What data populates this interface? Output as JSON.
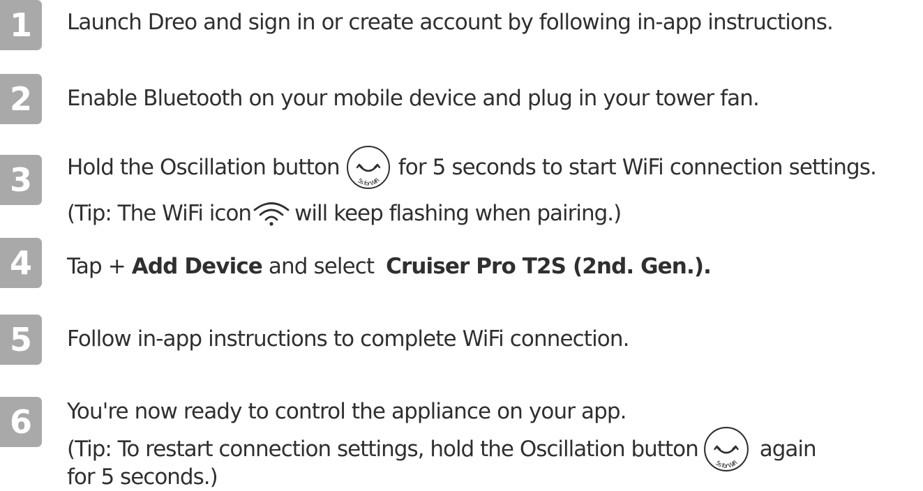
{
  "steps": [
    {
      "number": "1",
      "text": "Launch Dreo and sign in or create account by following in-app instructions."
    },
    {
      "number": "2",
      "text": "Enable Bluetooth on your mobile device and plug in your tower fan."
    },
    {
      "number": "3",
      "text_before": "Hold the Oscillation button",
      "text_after": "for 5 seconds to start WiFi connection settings.",
      "tip_before": "(Tip: The WiFi icon",
      "tip_after": "will keep flashing when pairing.)"
    },
    {
      "number": "4",
      "text_a": "Tap + ",
      "bold_a": "Add Device",
      "text_b": " and select ",
      "bold_b": "Cruiser Pro T2S (2nd. Gen.)."
    },
    {
      "number": "5",
      "text": "Follow in-app instructions to complete WiFi connection."
    },
    {
      "number": "6",
      "text": "You're now ready to control the appliance on your app.",
      "tip_before": "(Tip: To restart connection settings, hold the Oscillation button",
      "tip_after": "again",
      "tip_line2": "for 5 seconds.)"
    }
  ],
  "icons": {
    "oscillation": "oscillation-button-icon",
    "oscillation_caption": "5s for WiFi",
    "wifi": "wifi-icon"
  },
  "colors": {
    "badge": "#a9a9a9",
    "text": "#2f2f2f"
  }
}
